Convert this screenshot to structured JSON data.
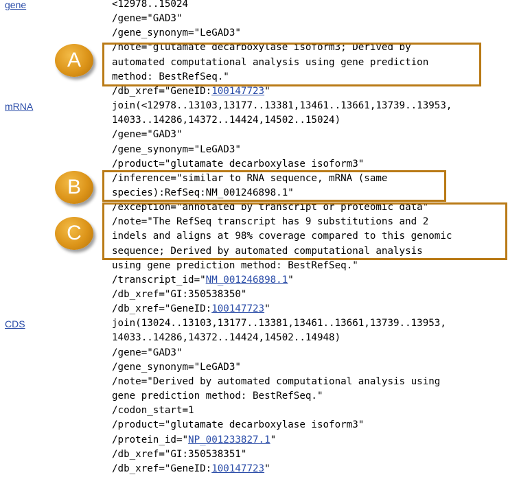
{
  "features": [
    {
      "key": "gene",
      "lines": [
        {
          "text": "<12978..15024"
        },
        {
          "text": "/gene=\"GAD3\""
        },
        {
          "text": "/gene_synonym=\"LeGAD3\""
        },
        {
          "text": "/note=\"glutamate decarboxylase isoform3; Derived by"
        },
        {
          "text": "automated computational analysis using gene prediction"
        },
        {
          "text": "method: BestRefSeq.\""
        },
        {
          "pre": "/db_xref=\"GeneID:",
          "link": "100147723",
          "post": "\""
        }
      ]
    },
    {
      "key": "mRNA",
      "lines": [
        {
          "text": "join(<12978..13103,13177..13381,13461..13661,13739..13953,"
        },
        {
          "text": "14033..14286,14372..14424,14502..15024)"
        },
        {
          "text": "/gene=\"GAD3\""
        },
        {
          "text": "/gene_synonym=\"LeGAD3\""
        },
        {
          "text": "/product=\"glutamate decarboxylase isoform3\""
        },
        {
          "text": "/inference=\"similar to RNA sequence, mRNA (same"
        },
        {
          "text": "species):RefSeq:NM_001246898.1\""
        },
        {
          "text": "/exception=\"annotated by transcript or proteomic data\""
        },
        {
          "text": "/note=\"The RefSeq transcript has 9 substitutions and 2"
        },
        {
          "text": "indels and aligns at 98% coverage compared to this genomic"
        },
        {
          "text": "sequence; Derived by automated computational analysis"
        },
        {
          "text": "using gene prediction method: BestRefSeq.\""
        },
        {
          "pre": "/transcript_id=\"",
          "link": "NM_001246898.1",
          "post": "\""
        },
        {
          "text": "/db_xref=\"GI:350538350\""
        },
        {
          "pre": "/db_xref=\"GeneID:",
          "link": "100147723",
          "post": "\""
        }
      ]
    },
    {
      "key": "CDS",
      "lines": [
        {
          "text": "join(13024..13103,13177..13381,13461..13661,13739..13953,"
        },
        {
          "text": "14033..14286,14372..14424,14502..14948)"
        },
        {
          "text": "/gene=\"GAD3\""
        },
        {
          "text": "/gene_synonym=\"LeGAD3\""
        },
        {
          "text": "/note=\"Derived by automated computational analysis using"
        },
        {
          "text": "gene prediction method: BestRefSeq.\""
        },
        {
          "text": "/codon_start=1"
        },
        {
          "text": "/product=\"glutamate decarboxylase isoform3\""
        },
        {
          "pre": "/protein_id=\"",
          "link": "NP_001233827.1",
          "post": "\""
        },
        {
          "text": "/db_xref=\"GI:350538351\""
        },
        {
          "pre": "/db_xref=\"GeneID:",
          "link": "100147723",
          "post": "\""
        }
      ]
    }
  ],
  "callouts": [
    {
      "label": "A"
    },
    {
      "label": "B"
    },
    {
      "label": "C"
    }
  ],
  "colors": {
    "link": "#2a4ca8",
    "callout_border": "#b97a16",
    "badge": "#dc9419"
  }
}
